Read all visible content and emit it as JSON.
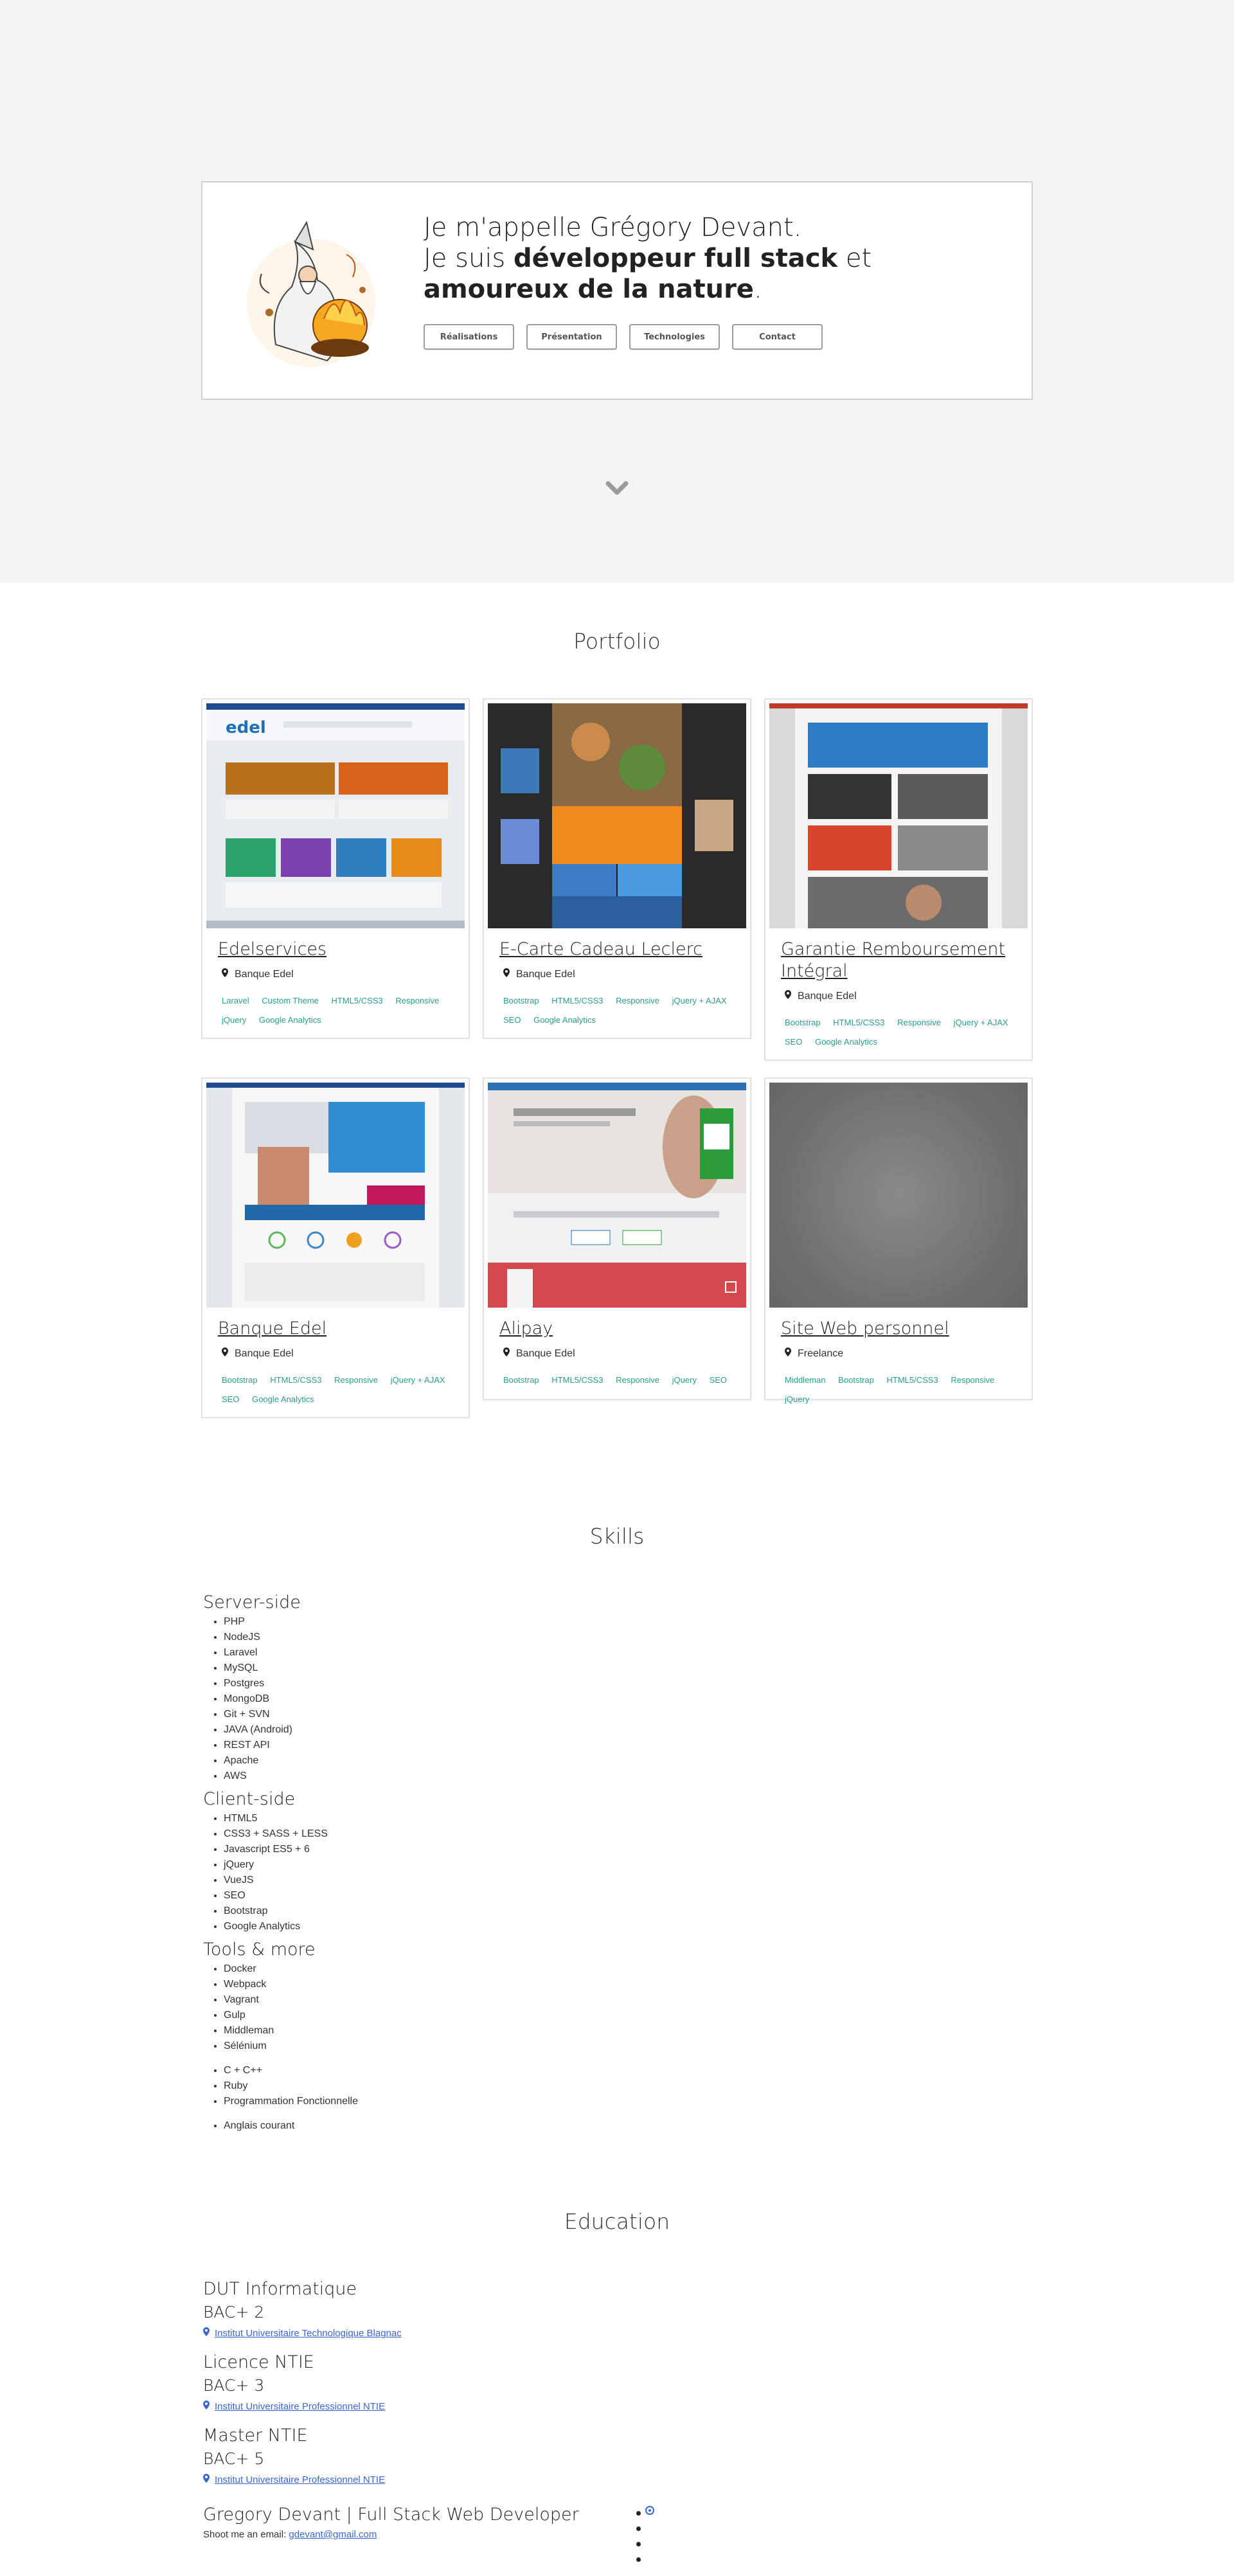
{
  "hero": {
    "line1": "Je m'appelle Grégory Devant.",
    "line2_pre": "Je suis ",
    "line2_b1": "développeur full stack",
    "line2_mid": " et ",
    "line2_b2": "amoureux de la nature",
    "line2_end": ".",
    "buttons": [
      "Réalisations",
      "Présentation",
      "Technologies",
      "Contact"
    ],
    "scroll_icon": "chevron-down-icon"
  },
  "portfolio": {
    "title": "Portfolio",
    "projects": [
      {
        "title": "Edelservices",
        "location": "Banque Edel",
        "tags": [
          "Laravel",
          "Custom Theme",
          "HTML5/CSS3",
          "Responsive",
          "jQuery",
          "Google Analytics"
        ]
      },
      {
        "title": "E-Carte Cadeau Leclerc",
        "location": "Banque Edel",
        "tags": [
          "Bootstrap",
          "HTML5/CSS3",
          "Responsive",
          "jQuery + AJAX",
          "SEO",
          "Google Analytics"
        ]
      },
      {
        "title": "Garantie Remboursement Intégral",
        "location": "Banque Edel",
        "tags": [
          "Bootstrap",
          "HTML5/CSS3",
          "Responsive",
          "jQuery + AJAX",
          "SEO",
          "Google Analytics"
        ]
      },
      {
        "title": "Banque Edel",
        "location": "Banque Edel",
        "tags": [
          "Bootstrap",
          "HTML5/CSS3",
          "Responsive",
          "jQuery + AJAX",
          "SEO",
          "Google Analytics"
        ]
      },
      {
        "title": "Alipay",
        "location": "Banque Edel",
        "tags": [
          "Bootstrap",
          "HTML5/CSS3",
          "Responsive",
          "jQuery",
          "SEO"
        ]
      },
      {
        "title": "Site Web personnel",
        "location": "Freelance",
        "tags": [
          "Middleman",
          "Bootstrap",
          "HTML5/CSS3",
          "Responsive",
          "jQuery"
        ]
      }
    ]
  },
  "skills": {
    "title": "Skills",
    "server_title": "Server-side",
    "server": [
      "PHP",
      "NodeJS",
      "Laravel",
      "MySQL",
      "Postgres",
      "MongoDB",
      "Git + SVN",
      "JAVA (Android)",
      "REST API",
      "Apache",
      "AWS"
    ],
    "client_title": "Client-side",
    "client": [
      "HTML5",
      "CSS3 + SASS + LESS",
      "Javascript ES5 + 6",
      "jQuery",
      "VueJS",
      "SEO",
      "Bootstrap",
      "Google Analytics"
    ],
    "tools_title": "Tools & more",
    "tools": [
      "Docker",
      "Webpack",
      "Vagrant",
      "Gulp",
      "Middleman",
      "Sélénium"
    ],
    "langs": [
      "C + C++",
      "Ruby",
      "Programmation Fonctionnelle"
    ],
    "spoken": [
      "Anglais courant"
    ]
  },
  "education": {
    "title": "Education",
    "items": [
      {
        "degree": "DUT Informatique",
        "level": "BAC+ 2",
        "school": "Institut Universitaire Technologique Blagnac"
      },
      {
        "degree": "Licence NTIE",
        "level": "BAC+ 3",
        "school": "Institut Universitaire Professionnel NTIE"
      },
      {
        "degree": "Master NTIE",
        "level": "BAC+ 5",
        "school": "Institut Universitaire Professionnel NTIE"
      }
    ]
  },
  "footer": {
    "title": "Gregory Devant | Full Stack Web Developer",
    "email_label": "Shoot me an email: ",
    "email": "gdevant@gmail.com",
    "social_icon": "github-icon"
  },
  "colors": {
    "hero_bg": "#f3f3f3",
    "tag": "#2a9d8f",
    "link": "#3a66d4"
  }
}
